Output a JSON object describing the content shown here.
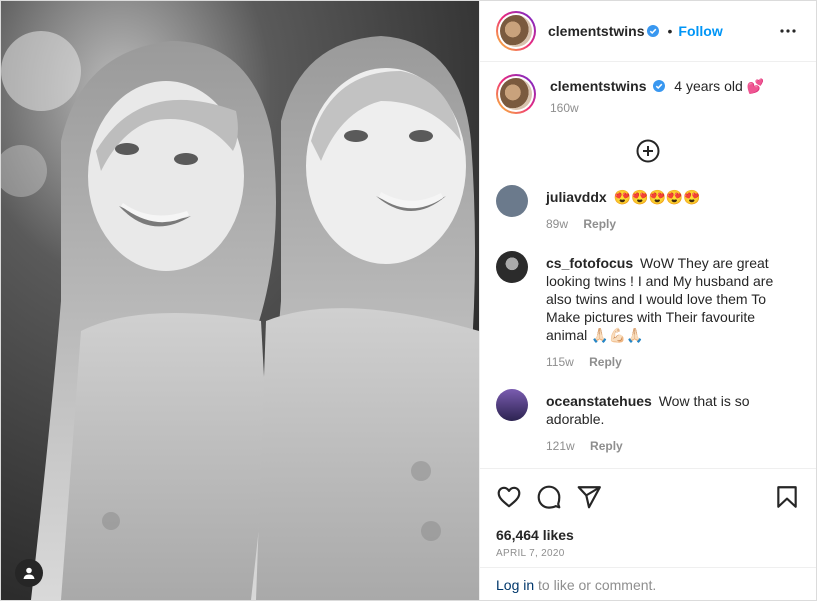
{
  "post": {
    "username": "clementstwins",
    "follow_label": "Follow",
    "dot": "•",
    "caption_text": "4 years old 💕",
    "caption_age": "160w"
  },
  "comments": [
    {
      "username": "juliavddx",
      "text": "😍😍😍😍😍",
      "age": "89w",
      "reply": "Reply",
      "avatar_color": "#6b7a8c"
    },
    {
      "username": "cs_fotofocus",
      "text": "WoW They are great looking twins ! I and My husband are also twins and I would love them To Make pictures with Their favourite animal 🙏🏻💪🏻🙏🏻",
      "age": "115w",
      "reply": "Reply",
      "avatar_color": "#2b2b2b"
    },
    {
      "username": "oceanstatehues",
      "text": "Wow that is so adorable.",
      "age": "121w",
      "reply": "Reply",
      "avatar_color": "#4b3a7a"
    }
  ],
  "footer": {
    "likes": "66,464 likes",
    "date": "April 7, 2020",
    "login_link": "Log in",
    "login_rest": " to like or comment."
  },
  "icons": {
    "heart": "heart-icon",
    "comment": "comment-icon",
    "share": "share-icon",
    "save": "bookmark-icon",
    "more": "more-options-icon",
    "add": "add-circle-icon",
    "tag": "user-tag-icon",
    "verified": "verified-badge-icon"
  },
  "colors": {
    "accent": "#0095f6",
    "link": "#00376b",
    "muted": "#8e8e8e",
    "verified": "#3897f0"
  }
}
